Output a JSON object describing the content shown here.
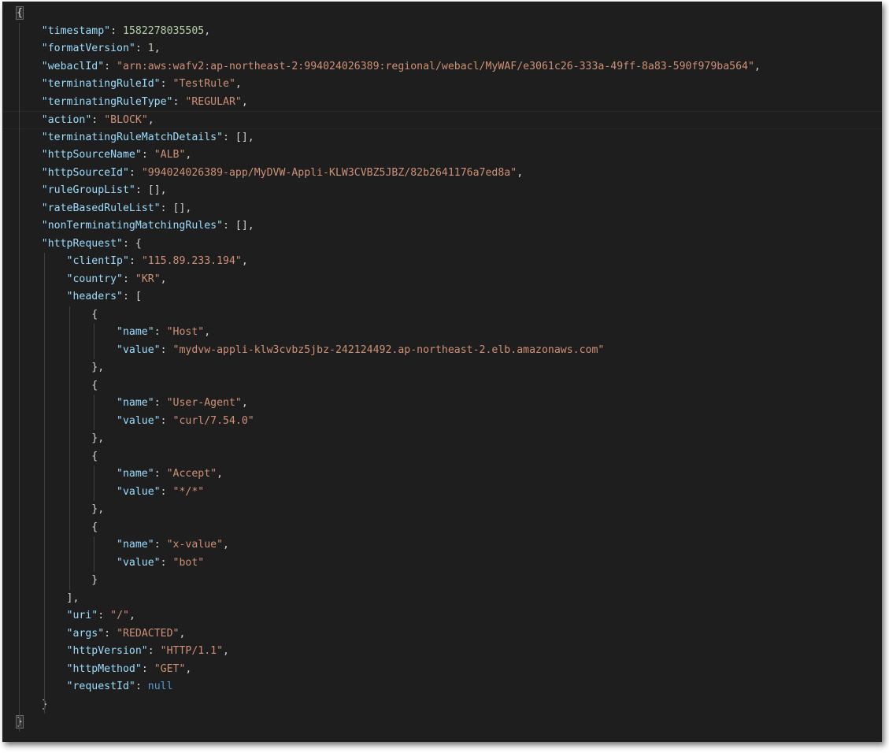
{
  "lines": [
    {
      "t": "open",
      "indent": 0,
      "text": "{"
    },
    {
      "t": "kv",
      "indent": 1,
      "key": "\"timestamp\"",
      "val": "1582278035505",
      "vtype": "num",
      "comma": true
    },
    {
      "t": "kv",
      "indent": 1,
      "key": "\"formatVersion\"",
      "val": "1",
      "vtype": "num",
      "comma": true
    },
    {
      "t": "kv",
      "indent": 1,
      "key": "\"webaclId\"",
      "val": "\"arn:aws:wafv2:ap-northeast-2:994024026389:regional/webacl/MyWAF/e3061c26-333a-49ff-8a83-590f979ba564\"",
      "vtype": "str",
      "comma": true
    },
    {
      "t": "kv",
      "indent": 1,
      "key": "\"terminatingRuleId\"",
      "val": "\"TestRule\"",
      "vtype": "str",
      "comma": true
    },
    {
      "t": "kv",
      "indent": 1,
      "key": "\"terminatingRuleType\"",
      "val": "\"REGULAR\"",
      "vtype": "str",
      "comma": true
    },
    {
      "t": "kv",
      "indent": 1,
      "key": "\"action\"",
      "val": "\"BLOCK\"",
      "vtype": "str",
      "comma": true,
      "cursor": true
    },
    {
      "t": "kv",
      "indent": 1,
      "key": "\"terminatingRuleMatchDetails\"",
      "val": "[]",
      "vtype": "punc",
      "comma": true
    },
    {
      "t": "kv",
      "indent": 1,
      "key": "\"httpSourceName\"",
      "val": "\"ALB\"",
      "vtype": "str",
      "comma": true
    },
    {
      "t": "kv",
      "indent": 1,
      "key": "\"httpSourceId\"",
      "val": "\"994024026389-app/MyDVW-Appli-KLW3CVBZ5JBZ/82b2641176a7ed8a\"",
      "vtype": "str",
      "comma": true
    },
    {
      "t": "kv",
      "indent": 1,
      "key": "\"ruleGroupList\"",
      "val": "[]",
      "vtype": "punc",
      "comma": true
    },
    {
      "t": "kv",
      "indent": 1,
      "key": "\"rateBasedRuleList\"",
      "val": "[]",
      "vtype": "punc",
      "comma": true
    },
    {
      "t": "kv",
      "indent": 1,
      "key": "\"nonTerminatingMatchingRules\"",
      "val": "[]",
      "vtype": "punc",
      "comma": true
    },
    {
      "t": "kv",
      "indent": 1,
      "key": "\"httpRequest\"",
      "val": "{",
      "vtype": "punc",
      "comma": false
    },
    {
      "t": "kv",
      "indent": 2,
      "key": "\"clientIp\"",
      "val": "\"115.89.233.194\"",
      "vtype": "str",
      "comma": true
    },
    {
      "t": "kv",
      "indent": 2,
      "key": "\"country\"",
      "val": "\"KR\"",
      "vtype": "str",
      "comma": true
    },
    {
      "t": "kv",
      "indent": 2,
      "key": "\"headers\"",
      "val": "[",
      "vtype": "punc",
      "comma": false
    },
    {
      "t": "open",
      "indent": 3,
      "text": "{"
    },
    {
      "t": "kv",
      "indent": 4,
      "key": "\"name\"",
      "val": "\"Host\"",
      "vtype": "str",
      "comma": true
    },
    {
      "t": "kv",
      "indent": 4,
      "key": "\"value\"",
      "val": "\"mydvw-appli-klw3cvbz5jbz-242124492.ap-northeast-2.elb.amazonaws.com\"",
      "vtype": "str",
      "comma": false
    },
    {
      "t": "open",
      "indent": 3,
      "text": "},"
    },
    {
      "t": "open",
      "indent": 3,
      "text": "{"
    },
    {
      "t": "kv",
      "indent": 4,
      "key": "\"name\"",
      "val": "\"User-Agent\"",
      "vtype": "str",
      "comma": true
    },
    {
      "t": "kv",
      "indent": 4,
      "key": "\"value\"",
      "val": "\"curl/7.54.0\"",
      "vtype": "str",
      "comma": false
    },
    {
      "t": "open",
      "indent": 3,
      "text": "},"
    },
    {
      "t": "open",
      "indent": 3,
      "text": "{"
    },
    {
      "t": "kv",
      "indent": 4,
      "key": "\"name\"",
      "val": "\"Accept\"",
      "vtype": "str",
      "comma": true
    },
    {
      "t": "kv",
      "indent": 4,
      "key": "\"value\"",
      "val": "\"*/*\"",
      "vtype": "str",
      "comma": false
    },
    {
      "t": "open",
      "indent": 3,
      "text": "},"
    },
    {
      "t": "open",
      "indent": 3,
      "text": "{"
    },
    {
      "t": "kv",
      "indent": 4,
      "key": "\"name\"",
      "val": "\"x-value\"",
      "vtype": "str",
      "comma": true
    },
    {
      "t": "kv",
      "indent": 4,
      "key": "\"value\"",
      "val": "\"bot\"",
      "vtype": "str",
      "comma": false
    },
    {
      "t": "open",
      "indent": 3,
      "text": "}"
    },
    {
      "t": "open",
      "indent": 2,
      "text": "],"
    },
    {
      "t": "kv",
      "indent": 2,
      "key": "\"uri\"",
      "val": "\"/\"",
      "vtype": "str",
      "comma": true
    },
    {
      "t": "kv",
      "indent": 2,
      "key": "\"args\"",
      "val": "\"REDACTED\"",
      "vtype": "str",
      "comma": true
    },
    {
      "t": "kv",
      "indent": 2,
      "key": "\"httpVersion\"",
      "val": "\"HTTP/1.1\"",
      "vtype": "str",
      "comma": true
    },
    {
      "t": "kv",
      "indent": 2,
      "key": "\"httpMethod\"",
      "val": "\"GET\"",
      "vtype": "str",
      "comma": true
    },
    {
      "t": "kv",
      "indent": 2,
      "key": "\"requestId\"",
      "val": "null",
      "vtype": "kw",
      "comma": false
    },
    {
      "t": "open",
      "indent": 1,
      "text": "}"
    },
    {
      "t": "open",
      "indent": 0,
      "text": "}"
    }
  ]
}
